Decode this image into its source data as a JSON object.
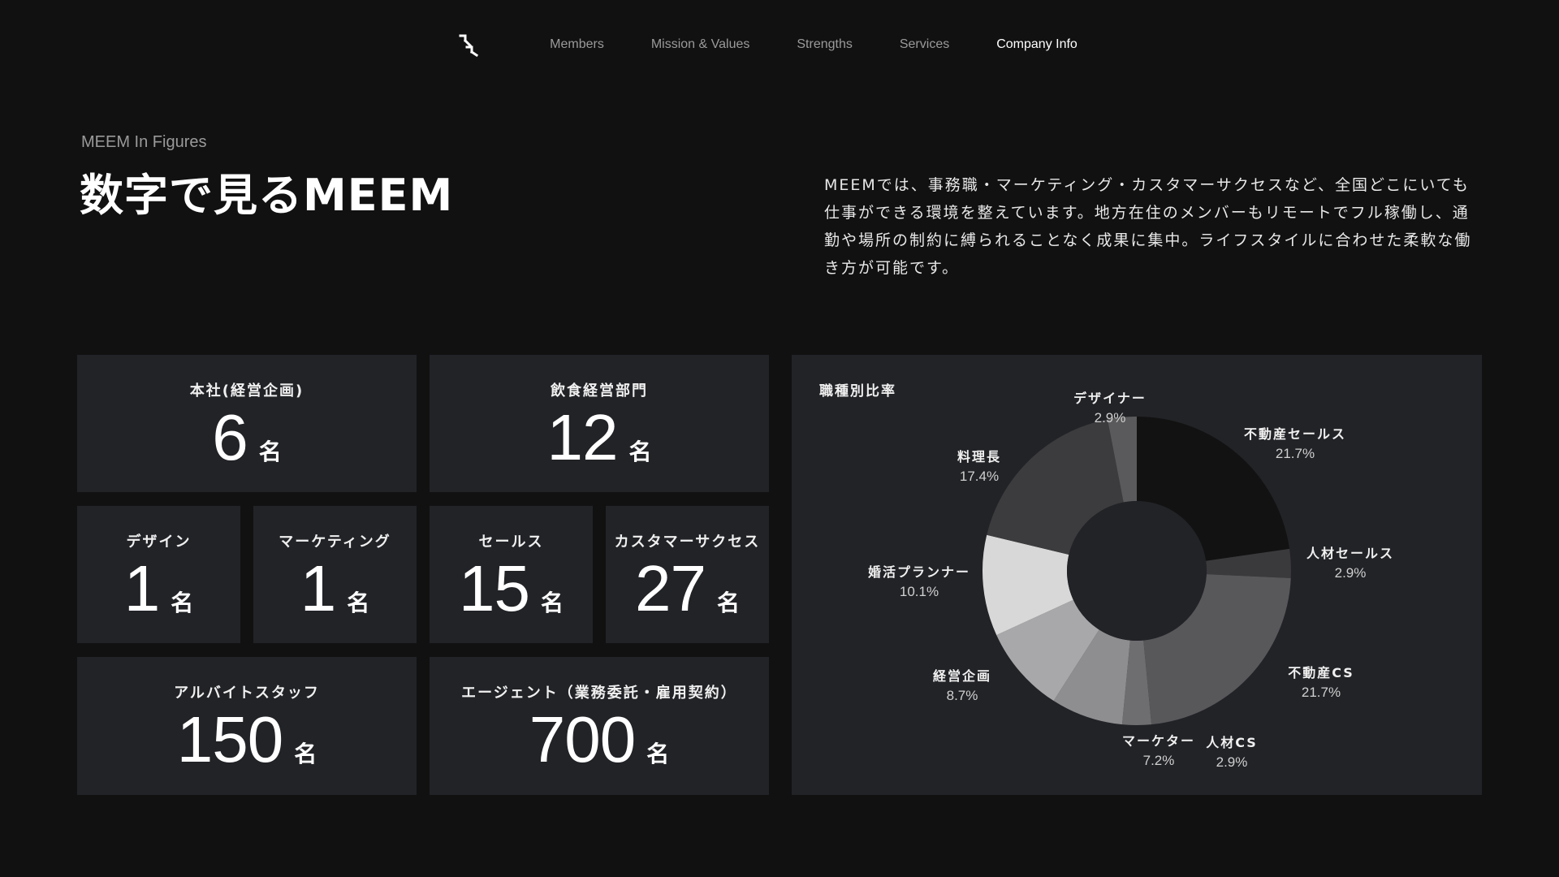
{
  "nav": {
    "logo_icon": "meem-logo-icon",
    "items": [
      {
        "label": "Members",
        "active": false
      },
      {
        "label": "Mission & Values",
        "active": false
      },
      {
        "label": "Strengths",
        "active": false
      },
      {
        "label": "Services",
        "active": false
      },
      {
        "label": "Company Info",
        "active": true
      }
    ]
  },
  "header": {
    "eyebrow": "MEEM In Figures",
    "title": "数字で見るMEEM",
    "description": "MEEMでは、事務職・マーケティング・カスタマーサクセスなど、全国どこにいても仕事ができる環境を整えています。地方在住のメンバーもリモートでフル稼働し、通勤や場所の制約に縛られることなく成果に集中。ライフスタイルに合わせた柔軟な働き方が可能です。"
  },
  "stats": {
    "honsha": {
      "label": "本社(経営企画)",
      "value": "6",
      "unit": "名"
    },
    "inshoku": {
      "label": "飲食経営部門",
      "value": "12",
      "unit": "名"
    },
    "design": {
      "label": "デザイン",
      "value": "1",
      "unit": "名"
    },
    "marketing": {
      "label": "マーケティング",
      "value": "1",
      "unit": "名"
    },
    "sales": {
      "label": "セールス",
      "value": "15",
      "unit": "名"
    },
    "cs": {
      "label": "カスタマーサクセス",
      "value": "27",
      "unit": "名"
    },
    "arubaito": {
      "label": "アルバイトスタッフ",
      "value": "150",
      "unit": "名"
    },
    "agent": {
      "label": "エージェント（業務委託・雇用契約）",
      "value": "700",
      "unit": "名"
    }
  },
  "chart_title": "職種別比率",
  "chart_data": {
    "type": "pie",
    "title": "職種別比率",
    "categories": [
      "不動産セールス",
      "人材セールス",
      "不動産CS",
      "人材CS",
      "マーケター",
      "経営企画",
      "婚活プランナー",
      "料理長",
      "デザイナー"
    ],
    "values": [
      21.7,
      2.9,
      21.7,
      2.9,
      7.2,
      8.7,
      10.1,
      17.4,
      2.9
    ],
    "labels": [
      "21.7%",
      "2.9%",
      "21.7%",
      "2.9%",
      "7.2%",
      "8.7%",
      "10.1%",
      "17.4%",
      "2.9%"
    ],
    "colors": [
      "#121212",
      "#3a3a3d",
      "#58585b",
      "#6e6e70",
      "#8e8e90",
      "#a8a8aa",
      "#d8d8d8",
      "#3c3c3e",
      "#5a5a5c"
    ],
    "donut": true
  }
}
